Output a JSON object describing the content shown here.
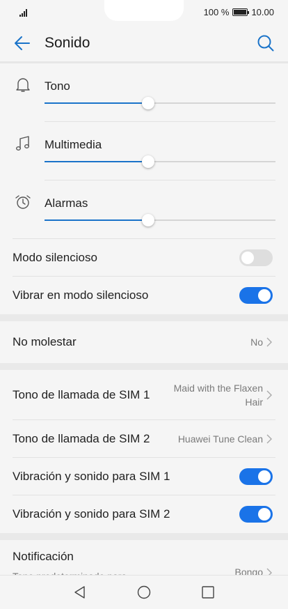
{
  "status_bar": {
    "battery_text": "100 %",
    "time": "10.00"
  },
  "header": {
    "title": "Sonido",
    "back_icon": "back-arrow-icon",
    "search_icon": "search-icon"
  },
  "accent_color": "#1a73e8",
  "volumes": [
    {
      "label": "Tono",
      "icon": "bell-icon",
      "level": 0.45
    },
    {
      "label": "Multimedia",
      "icon": "music-note-icon",
      "level": 0.45
    },
    {
      "label": "Alarmas",
      "icon": "alarm-clock-icon",
      "level": 0.45
    }
  ],
  "toggles_1": [
    {
      "label": "Modo silencioso",
      "on": false
    },
    {
      "label": "Vibrar en modo silencioso",
      "on": true
    }
  ],
  "no_molestar": {
    "label": "No molestar",
    "value": "No"
  },
  "sim_tones": [
    {
      "label": "Tono de llamada de SIM 1",
      "value": "Maid with the Flaxen Hair"
    },
    {
      "label": "Tono de llamada de SIM 2",
      "value": "Huawei Tune Clean"
    }
  ],
  "toggles_2": [
    {
      "label": "Vibración y sonido para SIM 1",
      "on": true
    },
    {
      "label": "Vibración y sonido para SIM 2",
      "on": true
    }
  ],
  "notification": {
    "label": "Notificación",
    "sub": "Tono predeterminado para Mensajes, Correo y Calendario",
    "value": "Bongo"
  },
  "nav": {
    "back": "nav-back-icon",
    "home": "nav-home-icon",
    "recents": "nav-recents-icon"
  }
}
